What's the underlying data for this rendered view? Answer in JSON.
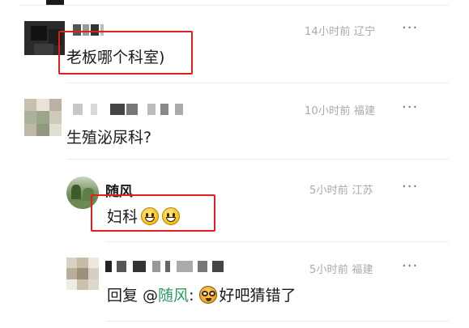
{
  "comments": [
    {
      "meta": "14小时前 辽宁",
      "text": "老板哪个科室)",
      "more": "···"
    },
    {
      "meta": "10小时前 福建",
      "text": "生殖泌尿科?",
      "more": "···"
    }
  ],
  "replies": [
    {
      "name": "随风",
      "meta": "5小时前 江苏",
      "text": "妇科",
      "emoji": "grinning-face-icon",
      "emoji_count": 2,
      "more": "···"
    },
    {
      "meta": "5小时前 福建",
      "prefix": "回复 @",
      "mention": "随风",
      "separator": ": ",
      "emoji": "nerd-face-icon",
      "text": "好吧猜错了",
      "more": "···"
    }
  ],
  "colors": {
    "highlight_box": "#e11d1d",
    "mention": "#2a9d5c",
    "meta_text": "#a9a9a9"
  }
}
